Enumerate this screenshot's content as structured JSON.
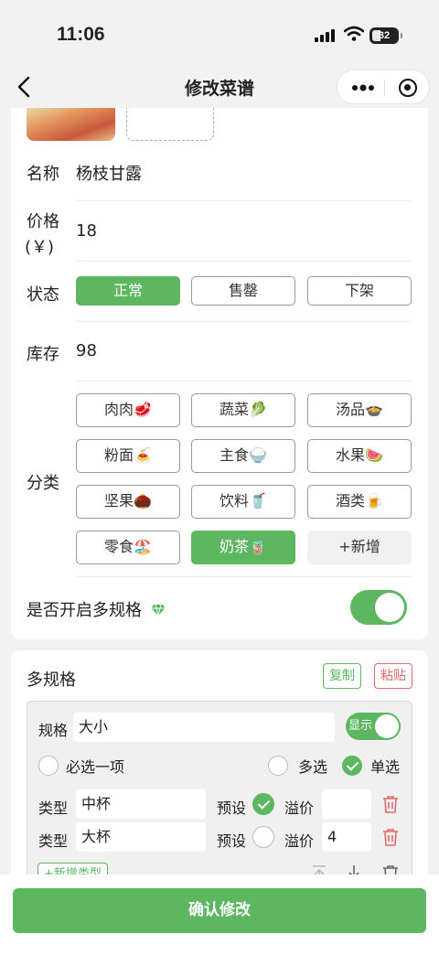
{
  "status_bar": {
    "time": "11:06",
    "battery": "32"
  },
  "nav": {
    "title": "修改菜谱"
  },
  "form": {
    "name_label": "名称",
    "name_value": "杨枝甘露",
    "price_label": "价格",
    "price_unit": "(￥)",
    "price_value": "18",
    "status_label": "状态",
    "status_options": [
      "正常",
      "售罄",
      "下架"
    ],
    "status_selected": "正常",
    "stock_label": "库存",
    "stock_value": "98",
    "category_label": "分类",
    "categories": [
      "肉肉🥩",
      "蔬菜🥬",
      "汤品🍲",
      "粉面🍝",
      "主食🍚",
      "水果🍉",
      "坚果🌰",
      "饮料🥤",
      "酒类🍺",
      "零食🏖️",
      "奶茶🧋",
      "+新增"
    ],
    "category_selected": "奶茶🧋",
    "multi_spec_label": "是否开启多规格",
    "multi_spec_enabled": true
  },
  "spec": {
    "title": "多规格",
    "copy_label": "复制",
    "paste_label": "粘贴",
    "spec_label": "规格",
    "spec_name": "大小",
    "show_label": "显示",
    "required_label": "必选一项",
    "multi_label": "多选",
    "single_label": "单选",
    "type_label": "类型",
    "preset_label": "预设",
    "premium_label": "溢价",
    "types": [
      {
        "name": "中杯",
        "preset": true,
        "premium": ""
      },
      {
        "name": "大杯",
        "preset": false,
        "premium": "4"
      }
    ],
    "add_type_label": "+新增类型"
  },
  "footer": {
    "confirm_label": "确认修改"
  },
  "colors": {
    "accent": "#5db760",
    "danger": "#e36a6a"
  }
}
